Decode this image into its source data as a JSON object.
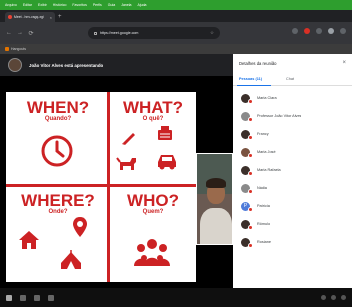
{
  "menubar": {
    "items": [
      "Arquivo",
      "Editar",
      "Exibir",
      "Histórico",
      "Favoritos",
      "Perfis",
      "Guia",
      "Janela",
      "Ajuda"
    ]
  },
  "browser": {
    "tab_title": "Meet - hnv-csgq-xgi",
    "url": "https://meet.google.com"
  },
  "meet": {
    "app_label": "Hangouts",
    "presenter_label": "João Vitor Alves está apresentando"
  },
  "slide": {
    "q1": {
      "big": "WHEN?",
      "small": "Quando?"
    },
    "q2": {
      "big": "WHAT?",
      "small": "O quê?"
    },
    "q3": {
      "big": "WHERE?",
      "small": "Onde?"
    },
    "q4": {
      "big": "WHO?",
      "small": "Quem?"
    },
    "accent_color": "#cc2224"
  },
  "panel": {
    "title": "Detalhes da reunião",
    "tab_people": "Pessoas (11)",
    "tab_chat": "Chat",
    "participants": [
      {
        "name": "Maria Clara",
        "avatar": "dark"
      },
      {
        "name": "Professor João Vitor Alves",
        "avatar": "gray"
      },
      {
        "name": "Francy",
        "avatar": "dark"
      },
      {
        "name": "Maria José",
        "avatar": "brown"
      },
      {
        "name": "Maria Rafaela",
        "avatar": "dark"
      },
      {
        "name": "Nádia",
        "avatar": "gray"
      },
      {
        "name": "Patrícia",
        "avatar": "blue",
        "initial": "P"
      },
      {
        "name": "Rômulo",
        "avatar": "dark"
      },
      {
        "name": "Rosiane",
        "avatar": "dark"
      }
    ]
  }
}
